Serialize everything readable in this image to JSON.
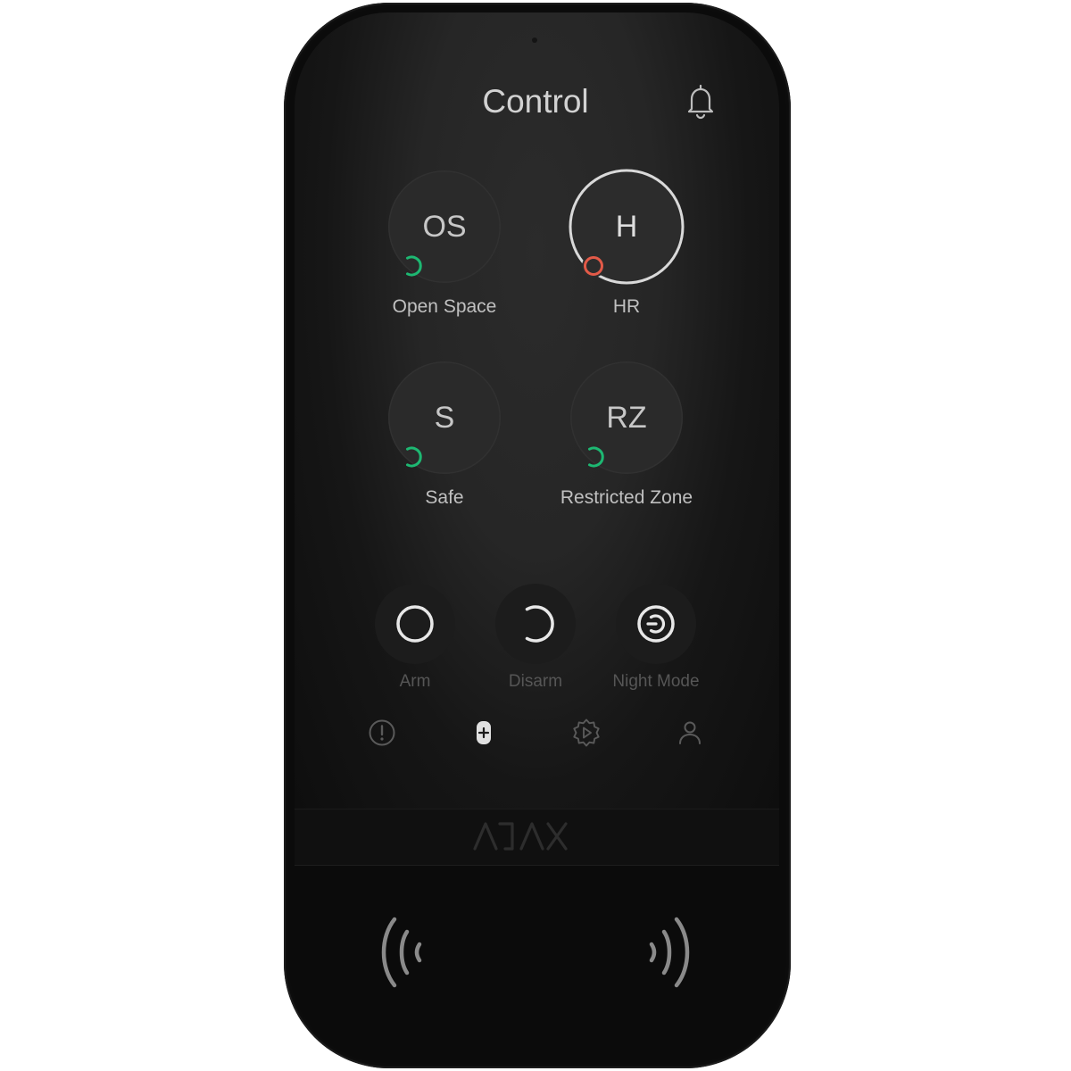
{
  "header": {
    "title": "Control",
    "bell_icon": "bell-icon"
  },
  "groups": [
    {
      "abbr": "OS",
      "name": "Open Space",
      "state": "disarmed",
      "status_color": "#1db872",
      "selected": false
    },
    {
      "abbr": "H",
      "name": "HR",
      "state": "armed",
      "status_color": "#e35a48",
      "selected": true
    },
    {
      "abbr": "S",
      "name": "Safe",
      "state": "disarmed",
      "status_color": "#1db872",
      "selected": false
    },
    {
      "abbr": "RZ",
      "name": "Restricted Zone",
      "state": "disarmed",
      "status_color": "#1db872",
      "selected": false
    }
  ],
  "modes": [
    {
      "label": "Arm",
      "icon": "arm-circle-icon"
    },
    {
      "label": "Disarm",
      "icon": "disarm-open-circle-icon"
    },
    {
      "label": "Night Mode",
      "icon": "night-mode-icon"
    }
  ],
  "nav": [
    {
      "name": "alerts",
      "icon": "alert-icon",
      "active": false
    },
    {
      "name": "control",
      "icon": "keypad-icon",
      "active": true
    },
    {
      "name": "scenarios",
      "icon": "scenario-gear-icon",
      "active": false
    },
    {
      "name": "user",
      "icon": "user-icon",
      "active": false
    }
  ],
  "brand": {
    "logo_text": "AJAX"
  },
  "colors": {
    "armed": "#e35a48",
    "disarmed": "#1db872",
    "text": "#d2d2d2",
    "muted": "#565656"
  }
}
